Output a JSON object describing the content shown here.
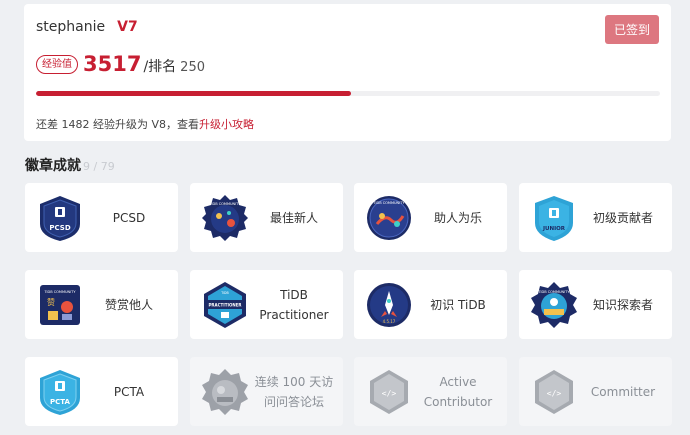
{
  "profile": {
    "username": "stephanie",
    "level": "V7",
    "signed_label": "已签到",
    "exp_badge": "经验值",
    "exp_value": "3517",
    "rank_label": "/排名",
    "rank_value": "250",
    "progress_fraction": 0.505,
    "upgrade_text": "还差 1482 经验升级为 V8，查看",
    "upgrade_link": "升级小攻略"
  },
  "badges_section": {
    "title": "徽章成就",
    "count": "9 / 79"
  },
  "badges": [
    {
      "name": "PCSD",
      "icon": "pcsd-badge-icon",
      "locked": false
    },
    {
      "name": "最佳新人",
      "icon": "best-newcomer-badge-icon",
      "locked": false
    },
    {
      "name": "助人为乐",
      "icon": "helping-others-badge-icon",
      "locked": false
    },
    {
      "name": "初级贡献者",
      "icon": "junior-contributor-badge-icon",
      "locked": false
    },
    {
      "name": "赞赏他人",
      "icon": "appreciate-others-badge-icon",
      "locked": false
    },
    {
      "name": "TiDB Practitioner",
      "icon": "tidb-practitioner-badge-icon",
      "locked": false
    },
    {
      "name": "初识 TiDB",
      "icon": "first-tidb-badge-icon",
      "locked": false
    },
    {
      "name": "知识探索者",
      "icon": "knowledge-explorer-badge-icon",
      "locked": false
    },
    {
      "name": "PCTA",
      "icon": "pcta-badge-icon",
      "locked": false
    },
    {
      "name": "连续 100 天访问问答论坛",
      "icon": "visit-100-days-badge-icon",
      "locked": true
    },
    {
      "name": "Active Contributor",
      "icon": "active-contributor-badge-icon",
      "locked": true
    },
    {
      "name": "Committer",
      "icon": "committer-badge-icon",
      "locked": true
    }
  ],
  "colors": {
    "accent": "#c71f32",
    "signed_button": "#dd7780",
    "background": "#eef0f3"
  }
}
